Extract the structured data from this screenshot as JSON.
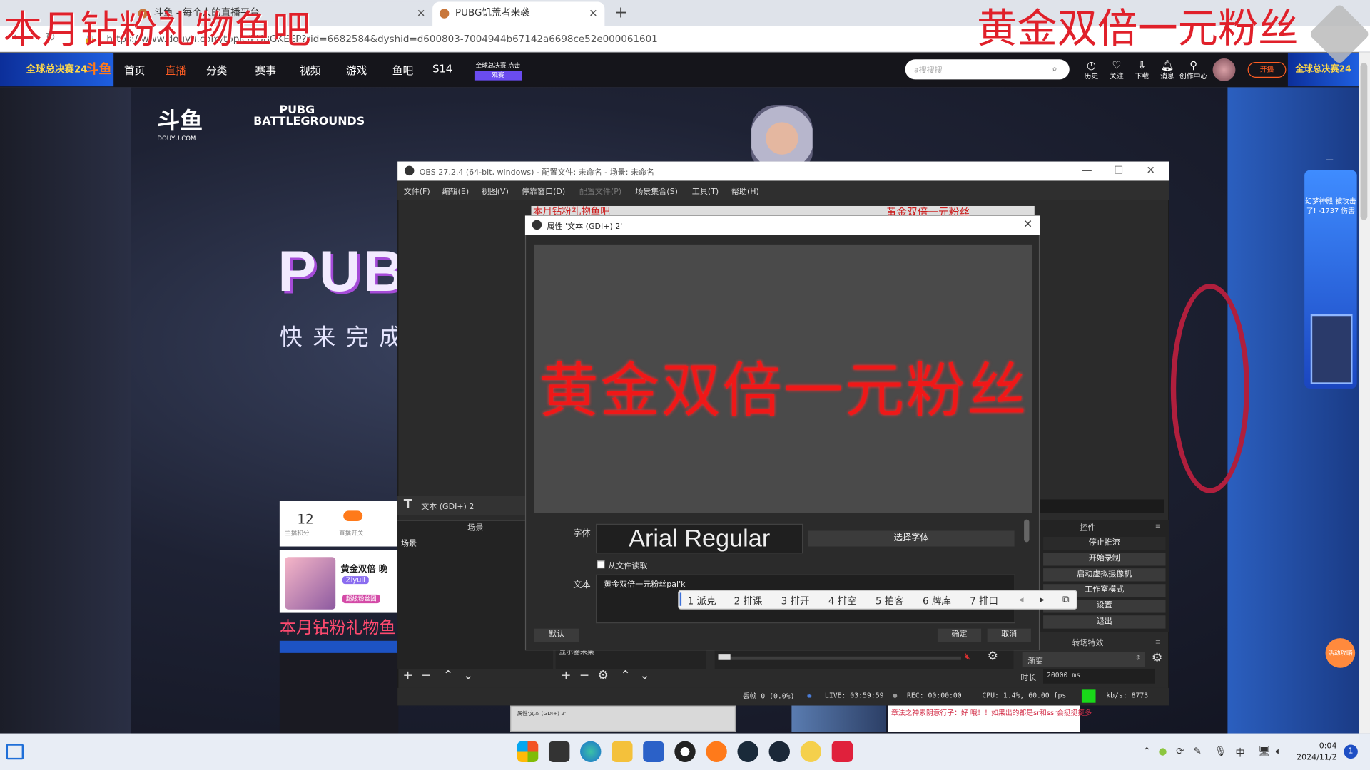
{
  "browser": {
    "tabs": [
      {
        "label": "斗鱼 - 每个人的直播平台"
      },
      {
        "label": "PUBG饥荒者来袭"
      }
    ],
    "new_tab": "+",
    "url": "https://www.douyu.com/topic/PUBGKEEP?rid=6682584&dyshid=d600803-7004944b67142a6698ce52e000061601"
  },
  "douyu_header": {
    "logo": "斗鱼",
    "banner_left": "全球总决赛24",
    "banner_right": "全球总决赛24",
    "nav": [
      "首页",
      "直播",
      "分类",
      "赛事",
      "视频",
      "游戏",
      "鱼吧",
      "S14"
    ],
    "promo": "全球总决赛 点击观赛",
    "search_placeholder": "a搜搜搜",
    "icons": [
      {
        "label": "历史",
        "icon": "history-icon"
      },
      {
        "label": "关注",
        "icon": "heart-icon"
      },
      {
        "label": "下载",
        "icon": "download-icon"
      },
      {
        "label": "消息",
        "icon": "bell-icon"
      },
      {
        "label": "创作中心",
        "icon": "bulb-icon"
      }
    ],
    "live_button": "开播"
  },
  "page": {
    "douyu_logo": "斗鱼",
    "douyu_domain": "DOUYU.COM",
    "bg_logo": "PUBG BATTLEGROUNDS",
    "hero": "PUBG",
    "hero_sub": "快来完成",
    "card_num": "12",
    "card_lbl1": "主播积分",
    "card_lbl2": "直播开关",
    "card_title": "黄金双倍 晚",
    "card_sub": "Ziyuli",
    "card_tag": "超级粉丝团",
    "pink_text": "本月钻粉礼物鱼",
    "right_card_text": "幻梦神殿 被攻击了! -1737 伤害",
    "side_button": "活动攻略",
    "thumb1": "属性'文本 (GDI+) 2'",
    "thumb3": "章法之神素阴意行子：好 哦！！如果出的都是sr和ssr会挺挺挺多"
  },
  "overlay": {
    "left_text": "本月钻粉礼物鱼吧",
    "right_text": "黄金双倍一元粉丝"
  },
  "obs": {
    "title": "OBS 27.2.4 (64-bit, windows) - 配置文件: 未命名 - 场景: 未命名",
    "menu": [
      "文件(F)",
      "编辑(E)",
      "视图(V)",
      "停靠窗口(D)",
      "配置文件(P)",
      "场景集合(S)",
      "工具(T)",
      "帮助(H)"
    ],
    "preview_left": "本月钻粉礼物鱼吧",
    "preview_right": "黄金双倍一元粉丝",
    "source_name": "文本 (GDI+) 2",
    "scenes_header": "场景",
    "scene_item": "场景",
    "source_item": "显示器采集",
    "controls_header": "控件",
    "controls": [
      "停止推流",
      "开始录制",
      "启动虚拟摄像机",
      "工作室模式",
      "设置",
      "退出"
    ],
    "transitions_header": "转场特效",
    "transition": "渐变",
    "duration_label": "时长",
    "duration": "20000 ms",
    "status": {
      "dropped": "丢帧 0 (0.0%)",
      "live": "LIVE: 03:59:59",
      "rec": "REC: 00:00:00",
      "cpu": "CPU: 1.4%, 60.00 fps",
      "kbs": "kb/s: 8773"
    }
  },
  "dialog": {
    "title": "属性 '文本 (GDI+) 2'",
    "preview_text": "黄金双倍一元粉丝",
    "font_label": "字体",
    "font_value": "Arial Regular",
    "font_button": "选择字体",
    "from_file": "从文件读取",
    "text_label": "文本",
    "text_value": "黄金双倍一元粉丝pai'k",
    "ime_candidates": [
      "1 派克",
      "2 排课",
      "3 排开",
      "4 排空",
      "5 拍客",
      "6 牌库",
      "7 排口"
    ],
    "default_button": "默认",
    "ok_button": "确定",
    "cancel_button": "取消"
  },
  "taskbar": {
    "time": "0:04",
    "date": "2024/11/2",
    "ime": "中",
    "badge": "1"
  }
}
